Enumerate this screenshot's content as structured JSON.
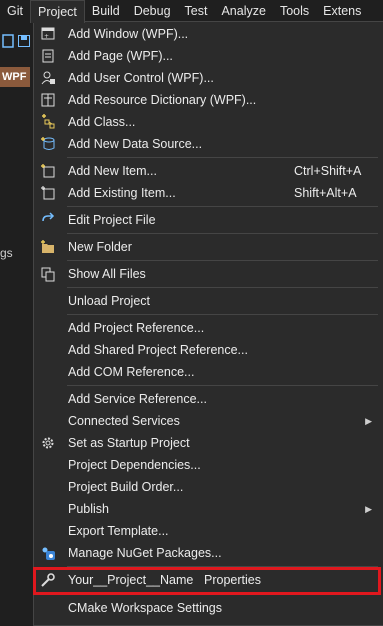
{
  "menubar": {
    "items": [
      "Git",
      "Project",
      "Build",
      "Debug",
      "Test",
      "Analyze",
      "Tools",
      "Extens"
    ]
  },
  "left": {
    "tab_label": "WPF",
    "side_text": "gs"
  },
  "menu": {
    "items": [
      {
        "label": "Add Window (WPF)...",
        "icon": "add-window-icon"
      },
      {
        "label": "Add Page (WPF)...",
        "icon": "add-page-icon"
      },
      {
        "label": "Add User Control (WPF)...",
        "icon": "add-user-control-icon"
      },
      {
        "label": "Add Resource Dictionary (WPF)...",
        "icon": "add-resource-dictionary-icon"
      },
      {
        "label": "Add Class...",
        "icon": "add-class-icon"
      },
      {
        "label": "Add New Data Source...",
        "icon": "add-data-source-icon"
      },
      {
        "label": "Add New Item...",
        "shortcut": "Ctrl+Shift+A",
        "icon": "add-new-item-icon"
      },
      {
        "label": "Add Existing Item...",
        "shortcut": "Shift+Alt+A",
        "icon": "add-existing-item-icon"
      },
      {
        "label": "Edit Project File",
        "icon": "edit-project-file-icon"
      },
      {
        "label": "New Folder",
        "icon": "new-folder-icon"
      },
      {
        "label": "Show All Files",
        "icon": "show-all-files-icon"
      },
      {
        "label": "Unload Project"
      },
      {
        "label": "Add Project Reference..."
      },
      {
        "label": "Add Shared Project Reference..."
      },
      {
        "label": "Add COM Reference..."
      },
      {
        "label": "Add Service Reference..."
      },
      {
        "label": "Connected Services",
        "submenu": "▶"
      },
      {
        "label": "Set as Startup Project",
        "icon": "gear-icon"
      },
      {
        "label": "Project Dependencies..."
      },
      {
        "label": "Project Build Order..."
      },
      {
        "label": "Publish",
        "submenu": "▶"
      },
      {
        "label": "Export Template..."
      },
      {
        "label": "Manage NuGet Packages...",
        "icon": "nuget-icon"
      },
      {
        "label": "Your__Project__Name",
        "extra": "Properties",
        "icon": "wrench-icon"
      },
      {
        "label": "CMake Workspace Settings"
      }
    ]
  },
  "colors": {
    "highlight": "#e0181e",
    "menu_bg": "#2b2b2b",
    "accent": "#75beff"
  }
}
